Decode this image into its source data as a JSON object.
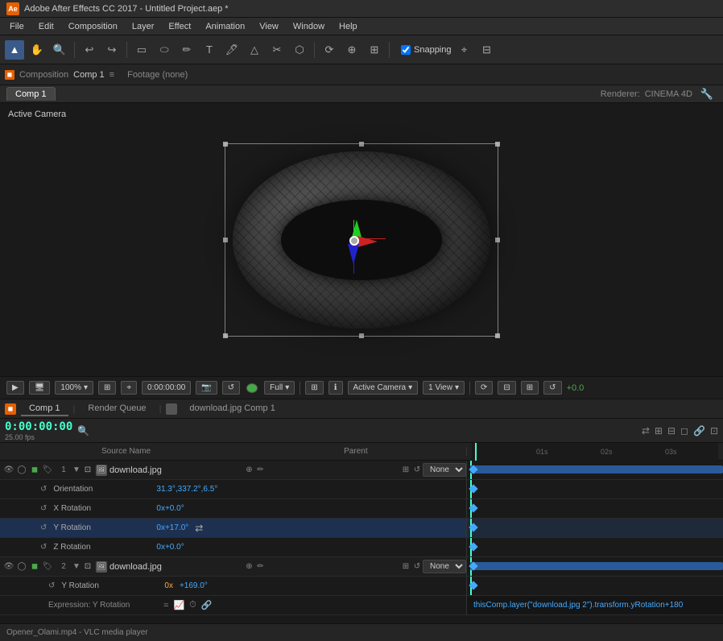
{
  "titlebar": {
    "title": "Adobe After Effects CC 2017 - Untitled Project.aep *"
  },
  "menubar": {
    "items": [
      "File",
      "Edit",
      "Composition",
      "Layer",
      "Effect",
      "Animation",
      "View",
      "Window",
      "Help"
    ]
  },
  "toolbar": {
    "tools": [
      "▲",
      "✋",
      "🔍",
      "↩",
      "↪",
      "⬜",
      "⭕",
      "✏",
      "T",
      "🖊",
      "△",
      "✂",
      "⬡",
      "➤"
    ],
    "snapping": "Snapping",
    "snapping_checked": true
  },
  "comp_tabs": {
    "composition_label": "Composition",
    "comp_name": "Comp 1",
    "footage_label": "Footage (none)",
    "active_tab": "Comp 1",
    "renderer_label": "Renderer:",
    "renderer_value": "CINEMA 4D"
  },
  "viewport": {
    "active_camera_label": "Active Camera",
    "zoom": "100%",
    "time": "0:00:00:00",
    "quality": "Full",
    "view": "Active Camera",
    "view_count": "1 View",
    "delta": "+0.0"
  },
  "timeline": {
    "tabs": [
      "Comp 1",
      "Render Queue",
      "download.jpg Comp 1"
    ],
    "active_tab": "Comp 1",
    "timecode": "0:00:00:00",
    "fps": "25.00 fps",
    "columns": {
      "source_name": "Source Name",
      "parent": "Parent"
    },
    "ruler": {
      "marks": [
        "01s",
        "02s",
        "03s"
      ]
    },
    "layers": [
      {
        "num": "1",
        "name": "download.jpg",
        "properties": [
          {
            "name": "Orientation",
            "value": "31.3°,337.2°,6.5°",
            "color": "blue"
          },
          {
            "name": "X Rotation",
            "value": "0x+0.0°",
            "color": "blue"
          },
          {
            "name": "Y Rotation",
            "value": "0x+17.0°",
            "color": "blue",
            "selected": true
          },
          {
            "name": "Z Rotation",
            "value": "0x+0.0°",
            "color": "blue"
          }
        ],
        "parent": "None"
      },
      {
        "num": "2",
        "name": "download.jpg",
        "properties": [
          {
            "name": "Y Rotation",
            "value": "0x+169.0°",
            "color": "orange-blue",
            "sub": true
          }
        ],
        "parent": "None",
        "expression": {
          "label": "Expression: Y Rotation",
          "text": "thisComp.layer(\"download.jpg 2\").transform.yRotation+180"
        }
      }
    ]
  },
  "bottom_bar": {
    "text": "Opener_Olami.mp4 - VLC media player"
  }
}
